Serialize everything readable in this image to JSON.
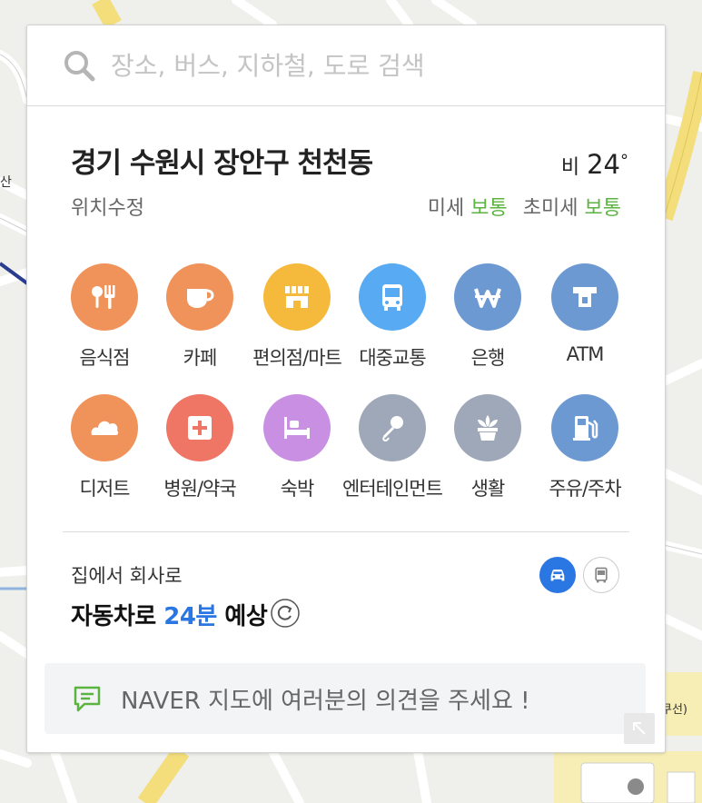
{
  "search": {
    "placeholder": "장소, 버스, 지하철, 도로 검색"
  },
  "location": {
    "title": "경기 수원시 장안구 천천동",
    "edit_label": "위치수정",
    "weather": {
      "condition": "비",
      "temperature": "24"
    },
    "dust": {
      "fine_label": "미세",
      "fine_value": "보통",
      "ultrafine_label": "초미세",
      "ultrafine_value": "보통"
    }
  },
  "categories": [
    {
      "label": "음식점",
      "icon": "restaurant-icon",
      "color": "#f0935a"
    },
    {
      "label": "카페",
      "icon": "cafe-icon",
      "color": "#f0935a"
    },
    {
      "label": "편의점/마트",
      "icon": "store-icon",
      "color": "#f5b93c"
    },
    {
      "label": "대중교통",
      "icon": "bus-icon",
      "color": "#58aaf2"
    },
    {
      "label": "은행",
      "icon": "won-icon",
      "color": "#6d99d3"
    },
    {
      "label": "ATM",
      "icon": "atm-icon",
      "color": "#6d99d3"
    },
    {
      "label": "디저트",
      "icon": "dessert-icon",
      "color": "#f0935a"
    },
    {
      "label": "병원/약국",
      "icon": "hospital-icon",
      "color": "#ef7565"
    },
    {
      "label": "숙박",
      "icon": "bed-icon",
      "color": "#c88fe3"
    },
    {
      "label": "엔터테인먼트",
      "icon": "microphone-icon",
      "color": "#9ea8b8"
    },
    {
      "label": "생활",
      "icon": "plant-icon",
      "color": "#9ea8b8"
    },
    {
      "label": "주유/주차",
      "icon": "gas-station-icon",
      "color": "#6d99d3"
    }
  ],
  "commute": {
    "title": "집에서 회사로",
    "mode_prefix": "자동차로",
    "duration": "24분",
    "suffix": "예상"
  },
  "feedback": {
    "text": "NAVER 지도에 여러분의 의견을 주세요 !"
  },
  "map": {
    "labels": [
      "산",
      "쿠선)"
    ]
  },
  "colors": {
    "accent": "#2a76e3",
    "good": "#5bb340"
  }
}
